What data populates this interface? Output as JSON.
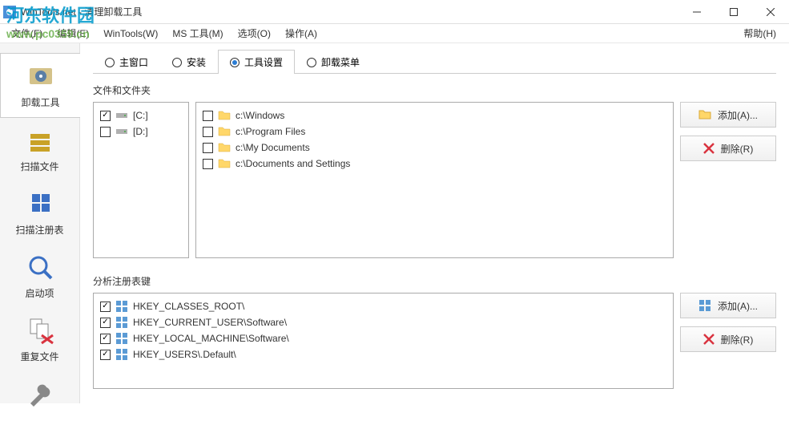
{
  "window": {
    "title": "WinTools.net - 清理卸载工具"
  },
  "menu": {
    "file": "文件(F)",
    "edit": "编辑(E)",
    "wintools": "WinTools(W)",
    "mstools": "MS 工具(M)",
    "options": "选项(O)",
    "actions": "操作(A)",
    "help": "帮助(H)"
  },
  "watermark": {
    "brand": "河东软件园",
    "url": "www.pc0359.cn"
  },
  "sidebar": {
    "items": [
      {
        "label": "卸载工具"
      },
      {
        "label": "扫描文件"
      },
      {
        "label": "扫描注册表"
      },
      {
        "label": "启动项"
      },
      {
        "label": "重复文件"
      }
    ]
  },
  "tabs": {
    "main_window": "主窗口",
    "install": "安装",
    "tool_settings": "工具设置",
    "uninstall_menu": "卸载菜单"
  },
  "section1": {
    "label": "文件和文件夹",
    "drives": [
      {
        "label": "[C:]",
        "checked": true
      },
      {
        "label": "[D:]",
        "checked": false
      }
    ],
    "folders": [
      {
        "path": "c:\\Windows",
        "checked": false
      },
      {
        "path": "c:\\Program Files",
        "checked": false
      },
      {
        "path": "c:\\My Documents",
        "checked": false
      },
      {
        "path": "c:\\Documents and Settings",
        "checked": false
      }
    ],
    "add": "添加(A)...",
    "remove": "删除(R)"
  },
  "section2": {
    "label": "分析注册表键",
    "keys": [
      {
        "path": "HKEY_CLASSES_ROOT\\",
        "checked": true
      },
      {
        "path": "HKEY_CURRENT_USER\\Software\\",
        "checked": true
      },
      {
        "path": "HKEY_LOCAL_MACHINE\\Software\\",
        "checked": true
      },
      {
        "path": "HKEY_USERS\\.Default\\",
        "checked": true
      }
    ],
    "add": "添加(A)...",
    "remove": "删除(R)"
  }
}
